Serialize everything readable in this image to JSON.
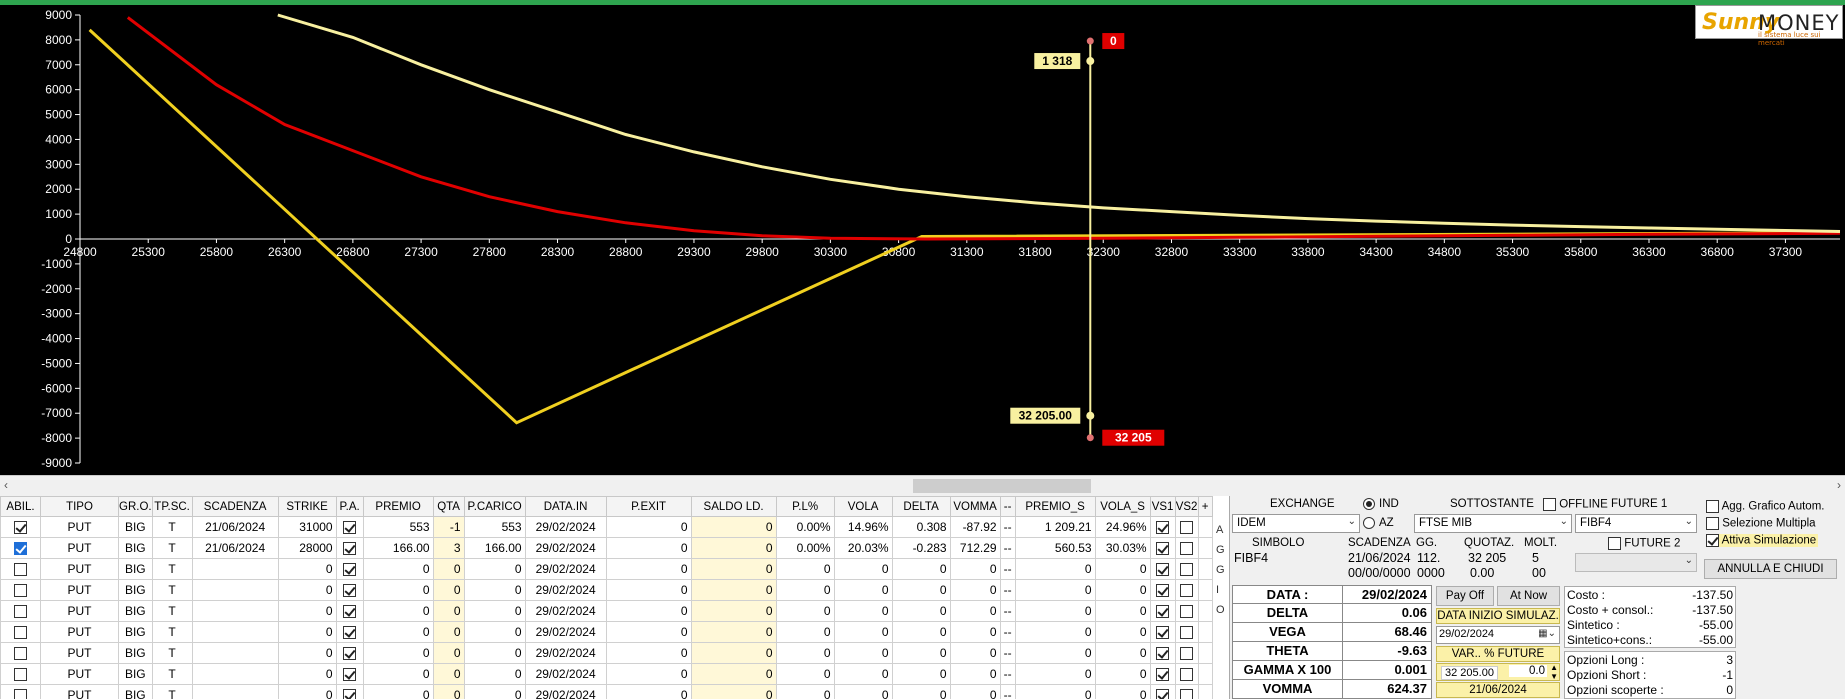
{
  "chart_data": {
    "type": "line",
    "title": "",
    "xlabel": "",
    "ylabel": "",
    "xlim": [
      24800,
      37700
    ],
    "ylim": [
      -9000,
      9000
    ],
    "x_ticks": [
      24800,
      25300,
      25800,
      26300,
      26800,
      27300,
      27800,
      28300,
      28800,
      29300,
      29800,
      30300,
      30800,
      31300,
      31800,
      32300,
      32800,
      33300,
      33800,
      34300,
      34800,
      35300,
      35800,
      36300,
      36800,
      37300
    ],
    "y_ticks": [
      9000,
      8000,
      7000,
      6000,
      5000,
      4000,
      3000,
      2000,
      1000,
      0,
      -1000,
      -2000,
      -3000,
      -4000,
      -5000,
      -6000,
      -7000,
      -8000,
      -9000
    ],
    "grid": false,
    "series": [
      {
        "color": "#f0d020",
        "values": [
          [
            24870,
            8400
          ],
          [
            28000,
            -7380
          ],
          [
            30970,
            100
          ],
          [
            37700,
            250
          ]
        ]
      },
      {
        "color": "#e00000",
        "values": [
          [
            25150,
            8900
          ],
          [
            25800,
            6200
          ],
          [
            26300,
            4600
          ],
          [
            27300,
            2500
          ],
          [
            27800,
            1700
          ],
          [
            28300,
            1100
          ],
          [
            28800,
            650
          ],
          [
            29300,
            330
          ],
          [
            29800,
            130
          ],
          [
            30300,
            30
          ],
          [
            31000,
            0
          ],
          [
            32300,
            30
          ],
          [
            33300,
            70
          ],
          [
            34300,
            110
          ],
          [
            35300,
            150
          ],
          [
            36300,
            190
          ],
          [
            37700,
            230
          ]
        ]
      },
      {
        "color": "#f8f0a0",
        "values": [
          [
            26250,
            9000
          ],
          [
            26800,
            8100
          ],
          [
            27300,
            7000
          ],
          [
            27800,
            6000
          ],
          [
            28300,
            5100
          ],
          [
            28800,
            4200
          ],
          [
            29300,
            3500
          ],
          [
            29800,
            2900
          ],
          [
            30300,
            2400
          ],
          [
            30800,
            2000
          ],
          [
            31300,
            1700
          ],
          [
            31800,
            1450
          ],
          [
            32300,
            1250
          ],
          [
            32800,
            1100
          ],
          [
            33300,
            950
          ],
          [
            33800,
            820
          ],
          [
            34300,
            720
          ],
          [
            34800,
            630
          ],
          [
            35300,
            560
          ],
          [
            35800,
            500
          ],
          [
            36300,
            440
          ],
          [
            36800,
            390
          ],
          [
            37300,
            340
          ],
          [
            37700,
            300
          ]
        ]
      }
    ],
    "cursor": {
      "x": 32205,
      "y_top": 7150,
      "y_bottom": -7100
    },
    "labels": {
      "top_value": "1 318",
      "top_tag": "0",
      "bottom_value": "32 205.00",
      "bottom_tag": "32 205"
    }
  },
  "logo": {
    "brand": "Sunny",
    "name": "MONEY",
    "tagline": "il sistema luce sui mercati"
  },
  "scrollbar": {
    "left_arrow": "‹",
    "right_arrow": "›"
  },
  "grid": {
    "columns": [
      "ABIL.",
      "TIPO",
      "GR.O.",
      "TP.SC.",
      "SCADENZA",
      "STRIKE",
      "P.A.",
      "PREMIO",
      "QTA",
      "P.CARICO",
      "DATA.IN",
      "P.EXIT",
      "SALDO LD.",
      "P.L%",
      "VOLA",
      "DELTA",
      "VOMMA",
      "--",
      "PREMIO_S",
      "VOLA_S",
      "VS1",
      "VS2",
      "+"
    ],
    "rows": [
      {
        "abil": "on",
        "tipo": "PUT",
        "gro": "BIG",
        "tpsc": "T",
        "scad": "21/06/2024",
        "strike": "31000",
        "pa": true,
        "premio": "553",
        "qta": "-1",
        "pcarico": "553",
        "datain": "29/02/2024",
        "pexit": "0",
        "saldo": "0",
        "pl": "0.00%",
        "vola": "14.96%",
        "delta": "0.308",
        "vomma": "-87.92",
        "dash": "--",
        "premios": "1 209.21",
        "volas": "24.96%",
        "vs1": true,
        "vs2": false
      },
      {
        "abil": "sel",
        "tipo": "PUT",
        "gro": "BIG",
        "tpsc": "T",
        "scad": "21/06/2024",
        "strike": "28000",
        "pa": true,
        "premio": "166.00",
        "qta": "3",
        "pcarico": "166.00",
        "datain": "29/02/2024",
        "pexit": "0",
        "saldo": "0",
        "pl": "0.00%",
        "vola": "20.03%",
        "delta": "-0.283",
        "vomma": "712.29",
        "dash": "--",
        "premios": "560.53",
        "volas": "30.03%",
        "vs1": true,
        "vs2": false
      },
      {
        "abil": "off",
        "tipo": "PUT",
        "gro": "BIG",
        "tpsc": "T",
        "scad": "",
        "strike": "0",
        "pa": true,
        "premio": "0",
        "qta": "0",
        "pcarico": "0",
        "datain": "29/02/2024",
        "pexit": "0",
        "saldo": "0",
        "pl": "0",
        "vola": "0",
        "delta": "0",
        "vomma": "0",
        "dash": "--",
        "premios": "0",
        "volas": "0",
        "vs1": true,
        "vs2": false
      },
      {
        "abil": "off",
        "tipo": "PUT",
        "gro": "BIG",
        "tpsc": "T",
        "scad": "",
        "strike": "0",
        "pa": true,
        "premio": "0",
        "qta": "0",
        "pcarico": "0",
        "datain": "29/02/2024",
        "pexit": "0",
        "saldo": "0",
        "pl": "0",
        "vola": "0",
        "delta": "0",
        "vomma": "0",
        "dash": "--",
        "premios": "0",
        "volas": "0",
        "vs1": true,
        "vs2": false
      },
      {
        "abil": "off",
        "tipo": "PUT",
        "gro": "BIG",
        "tpsc": "T",
        "scad": "",
        "strike": "0",
        "pa": true,
        "premio": "0",
        "qta": "0",
        "pcarico": "0",
        "datain": "29/02/2024",
        "pexit": "0",
        "saldo": "0",
        "pl": "0",
        "vola": "0",
        "delta": "0",
        "vomma": "0",
        "dash": "--",
        "premios": "0",
        "volas": "0",
        "vs1": true,
        "vs2": false
      },
      {
        "abil": "off",
        "tipo": "PUT",
        "gro": "BIG",
        "tpsc": "T",
        "scad": "",
        "strike": "0",
        "pa": true,
        "premio": "0",
        "qta": "0",
        "pcarico": "0",
        "datain": "29/02/2024",
        "pexit": "0",
        "saldo": "0",
        "pl": "0",
        "vola": "0",
        "delta": "0",
        "vomma": "0",
        "dash": "--",
        "premios": "0",
        "volas": "0",
        "vs1": true,
        "vs2": false
      },
      {
        "abil": "off",
        "tipo": "PUT",
        "gro": "BIG",
        "tpsc": "T",
        "scad": "",
        "strike": "0",
        "pa": true,
        "premio": "0",
        "qta": "0",
        "pcarico": "0",
        "datain": "29/02/2024",
        "pexit": "0",
        "saldo": "0",
        "pl": "0",
        "vola": "0",
        "delta": "0",
        "vomma": "0",
        "dash": "--",
        "premios": "0",
        "volas": "0",
        "vs1": true,
        "vs2": false
      },
      {
        "abil": "off",
        "tipo": "PUT",
        "gro": "BIG",
        "tpsc": "T",
        "scad": "",
        "strike": "0",
        "pa": true,
        "premio": "0",
        "qta": "0",
        "pcarico": "0",
        "datain": "29/02/2024",
        "pexit": "0",
        "saldo": "0",
        "pl": "0",
        "vola": "0",
        "delta": "0",
        "vomma": "0",
        "dash": "--",
        "premios": "0",
        "volas": "0",
        "vs1": true,
        "vs2": false
      },
      {
        "abil": "off",
        "tipo": "PUT",
        "gro": "BIG",
        "tpsc": "T",
        "scad": "",
        "strike": "0",
        "pa": true,
        "premio": "0",
        "qta": "0",
        "pcarico": "0",
        "datain": "29/02/2024",
        "pexit": "0",
        "saldo": "0",
        "pl": "0",
        "vola": "0",
        "delta": "0",
        "vomma": "0",
        "dash": "--",
        "premios": "0",
        "volas": "0",
        "vs1": true,
        "vs2": false
      }
    ]
  },
  "side_letters": [
    "A",
    "G",
    "G",
    "I",
    "O"
  ],
  "panel": {
    "exchange_label": "EXCHANGE",
    "radio_ind": "IND",
    "radio_az": "AZ",
    "sottostante_label": "SOTTOSTANTE",
    "offline_label": "OFFLINE",
    "future1_label": "FUTURE 1",
    "exchange_value": "IDEM",
    "sottostante_value": "FTSE MIB",
    "future1_value": "FIBF4",
    "future2_label": "FUTURE 2",
    "simbolo_label": "SIMBOLO",
    "scadenza_label": "SCADENZA",
    "gg_label": "GG.",
    "quotaz_label": "QUOTAZ.",
    "molt_label": "MOLT.",
    "simbolo_value": "FIBF4",
    "scadenza_value": "21/06/2024",
    "gg_value": "112.",
    "quotaz_value": "32 205",
    "molt_value": "5",
    "scadenza_value2": "00/00/0000",
    "gg_value2": "0000",
    "quotaz_value2": "0.00",
    "molt_value2": "00",
    "opt_agg": "Agg. Grafico Autom.",
    "opt_sel": "Selezione Multipla",
    "opt_sim": "Attiva Simulazione",
    "annulla": "ANNULLA E CHIUDI",
    "greeks": [
      {
        "k": "DATA :",
        "v": "29/02/2024"
      },
      {
        "k": "DELTA",
        "v": "0.06"
      },
      {
        "k": "VEGA",
        "v": "68.46"
      },
      {
        "k": "THETA",
        "v": "-9.63"
      },
      {
        "k": "GAMMA X 100",
        "v": "0.001"
      },
      {
        "k": "VOMMA",
        "v": "624.37"
      }
    ],
    "payoff_btn": "Pay Off",
    "atnow_btn": "At Now",
    "data_inizio": "DATA INIZIO SIMULAZ.",
    "data_inizio_value": "29/02/2024",
    "var_future": "VAR.. % FUTURE",
    "future_price": "32 205.00",
    "future_pct": "0.0",
    "future_date": "21/06/2024",
    "costs": [
      {
        "k": "Costo :",
        "v": "-137.50"
      },
      {
        "k": "Costo + consol.:",
        "v": "-137.50"
      },
      {
        "k": "Sintetico :",
        "v": "-55.00"
      },
      {
        "k": "Sintetico+cons.:",
        "v": "-55.00"
      }
    ],
    "counts": [
      {
        "k": "Opzioni Long :",
        "v": "3"
      },
      {
        "k": "Opzioni Short :",
        "v": "-1"
      },
      {
        "k": "Opzioni scoperte :",
        "v": "0"
      }
    ]
  }
}
